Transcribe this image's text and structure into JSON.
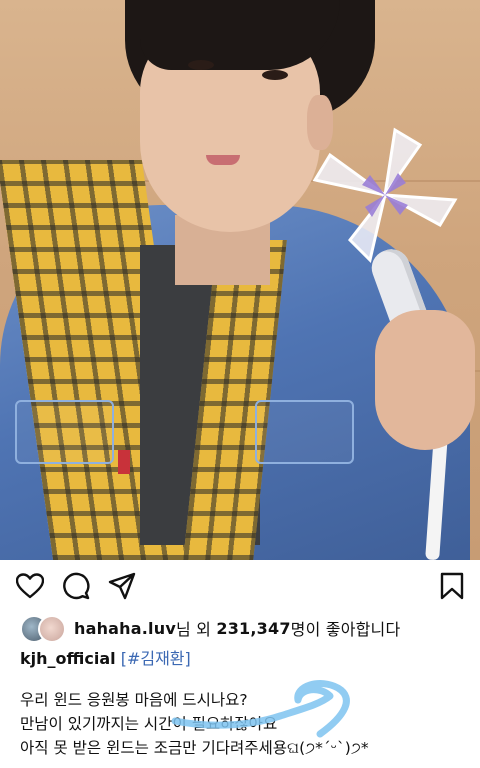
{
  "post": {
    "action_icons": [
      "heart-icon",
      "comment-icon",
      "share-icon",
      "bookmark-icon"
    ],
    "likes": {
      "liker": "hahaha.luv",
      "text_mid": "님 외 ",
      "count": "231,347",
      "text_end": "명이 좋아합니다"
    },
    "author": "kjh_official",
    "hashtag": "[#김재환]",
    "caption_lines": [
      "우리 윈드 응원봉 마음에 드시나요?",
      "만남이 있기까지는 시간이 필요하잖아요",
      "아직 못 받은 윈드는 조금만 기다려주세용ଘ(੭*ˊᵕˋ)੭*"
    ],
    "colors": {
      "hashtag": "#3b68b3",
      "scribble": "#7ec3f0"
    }
  }
}
